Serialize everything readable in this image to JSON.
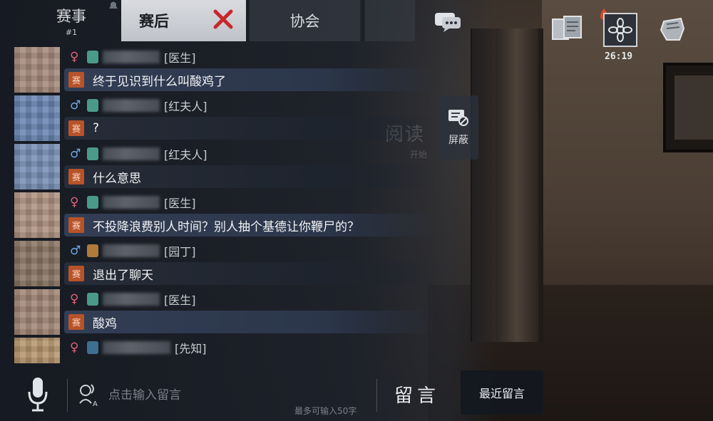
{
  "tabs": {
    "match": {
      "label": "赛事",
      "sub": "#1"
    },
    "post_match": {
      "label": "赛后"
    },
    "association": {
      "label": "协会"
    }
  },
  "hud": {
    "timer": "26:19"
  },
  "messages": [
    {
      "gender": "♀",
      "gender_type": "female",
      "role": "[医生]",
      "tag": "赛",
      "text": "终于见识到什么叫酸鸡了",
      "style": "blue",
      "avatar_color": "#a88c7e"
    },
    {
      "gender": "♂",
      "gender_type": "male",
      "role": "[红夫人]",
      "tag": "赛",
      "text": "?",
      "style": "dark",
      "avatar_color": "#6d88b4"
    },
    {
      "gender": "♂",
      "gender_type": "male",
      "role": "[红夫人]",
      "tag": "赛",
      "text": "什么意思",
      "style": "dark",
      "avatar_color": "#7a92b8"
    },
    {
      "gender": "♀",
      "gender_type": "female",
      "role": "[医生]",
      "tag": "赛",
      "text": "不投降浪费别人时间？别人抽个基德让你鞭尸的？",
      "style": "blue",
      "avatar_color": "#b09483"
    },
    {
      "gender": "♂",
      "gender_type": "male",
      "role": "[园丁]",
      "tag": "赛",
      "text": "退出了聊天",
      "style": "dark",
      "avatar_color": "#8b7766"
    },
    {
      "gender": "♀",
      "gender_type": "female",
      "role": "[医生]",
      "tag": "赛",
      "text": "酸鸡",
      "style": "blue",
      "avatar_color": "#a48979"
    },
    {
      "gender": "♀",
      "gender_type": "female",
      "role": "[先知]",
      "tag": "",
      "text": "",
      "style": "none",
      "avatar_color": "#b89870"
    }
  ],
  "mute_button": {
    "label": "屏蔽"
  },
  "background_text": {
    "main": "阅读",
    "sub": "开始"
  },
  "input": {
    "placeholder": "点击输入留言",
    "char_limit": "最多可输入50字"
  },
  "post_button": {
    "label": "留言"
  },
  "recent_button": {
    "label": "最近留言"
  },
  "colors": {
    "tag_bg": "#b7532a",
    "female": "#e0607a",
    "male": "#6aa7e6",
    "close_red": "#c6282b"
  }
}
